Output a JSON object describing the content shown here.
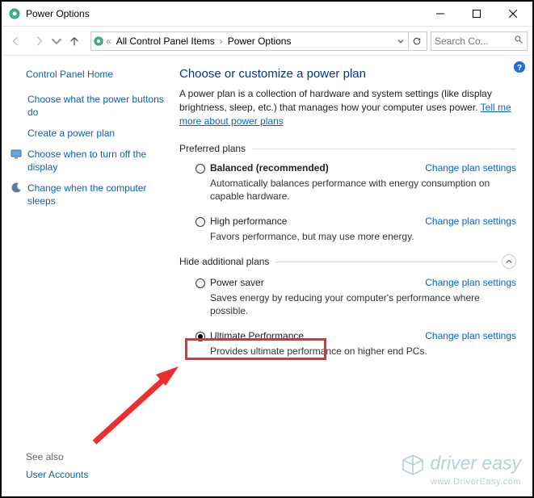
{
  "window": {
    "title": "Power Options",
    "min_tooltip": "Minimize",
    "max_tooltip": "Maximize",
    "close_tooltip": "Close"
  },
  "breadcrumb": {
    "item1": "All Control Panel Items",
    "item2": "Power Options"
  },
  "search": {
    "placeholder": "Search Co..."
  },
  "sidebar": {
    "home": "Control Panel Home",
    "links": [
      "Choose what the power buttons do",
      "Create a power plan",
      "Choose when to turn off the display",
      "Change when the computer sleeps"
    ],
    "see_also": "See also",
    "user_accounts": "User Accounts"
  },
  "main": {
    "heading": "Choose or customize a power plan",
    "desc_pre": "A power plan is a collection of hardware and system settings (like display brightness, sleep, etc.) that manages how your computer uses power. ",
    "desc_link": "Tell me more about power plans",
    "preferred_hdr": "Preferred plans",
    "hide_hdr": "Hide additional plans",
    "change_link": "Change plan settings",
    "plans": {
      "balanced": {
        "name": "Balanced (recommended)",
        "desc": "Automatically balances performance with energy consumption on capable hardware."
      },
      "high": {
        "name": "High performance",
        "desc": "Favors performance, but may use more energy."
      },
      "saver": {
        "name": "Power saver",
        "desc": "Saves energy by reducing your computer's performance where possible."
      },
      "ultimate": {
        "name": "Ultimate Performance",
        "desc": "Provides ultimate performance on higher end PCs."
      }
    }
  },
  "watermark": {
    "brand": "driver easy",
    "url": "www.DriverEasy.com"
  },
  "colors": {
    "accent": "#0066cc",
    "highlight": "#eb2f2f"
  }
}
